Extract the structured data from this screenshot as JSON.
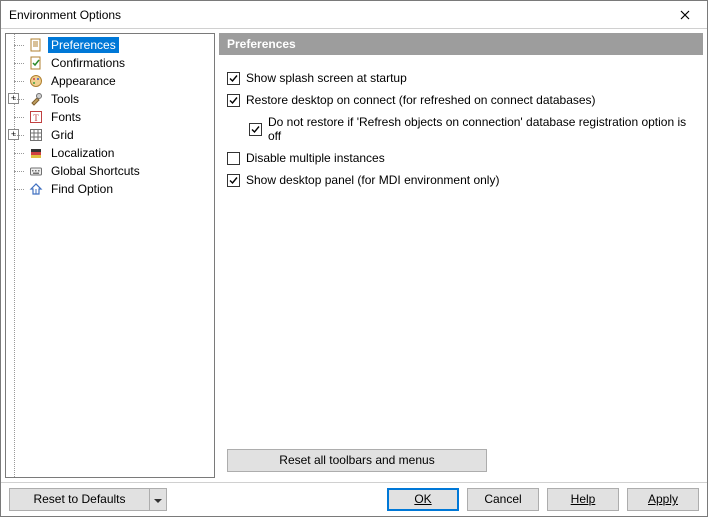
{
  "window": {
    "title": "Environment Options"
  },
  "tree": {
    "items": [
      {
        "label": "Preferences",
        "icon": "page",
        "selected": true,
        "expandable": false
      },
      {
        "label": "Confirmations",
        "icon": "page-check",
        "selected": false,
        "expandable": false
      },
      {
        "label": "Appearance",
        "icon": "palette",
        "selected": false,
        "expandable": false
      },
      {
        "label": "Tools",
        "icon": "tools",
        "selected": false,
        "expandable": true
      },
      {
        "label": "Fonts",
        "icon": "font",
        "selected": false,
        "expandable": false
      },
      {
        "label": "Grid",
        "icon": "grid",
        "selected": false,
        "expandable": true
      },
      {
        "label": "Localization",
        "icon": "flag",
        "selected": false,
        "expandable": false
      },
      {
        "label": "Global Shortcuts",
        "icon": "keyboard",
        "selected": false,
        "expandable": false
      },
      {
        "label": "Find Option",
        "icon": "find",
        "selected": false,
        "expandable": false
      }
    ]
  },
  "content": {
    "header": "Preferences",
    "options": [
      {
        "label": "Show splash screen at startup",
        "checked": true,
        "indent": false
      },
      {
        "label": "Restore desktop on connect (for refreshed on connect databases)",
        "checked": true,
        "indent": false
      },
      {
        "label": "Do not restore if 'Refresh objects on connection' database registration option is off",
        "checked": true,
        "indent": true
      },
      {
        "label": "Disable multiple instances",
        "checked": false,
        "indent": false
      },
      {
        "label": "Show desktop panel (for MDI environment only)",
        "checked": true,
        "indent": false
      }
    ],
    "reset_toolbars_label": "Reset all toolbars and menus"
  },
  "footer": {
    "reset_defaults_label": "Reset to Defaults",
    "ok_label": "OK",
    "cancel_label": "Cancel",
    "help_label": "Help",
    "apply_label": "Apply"
  }
}
